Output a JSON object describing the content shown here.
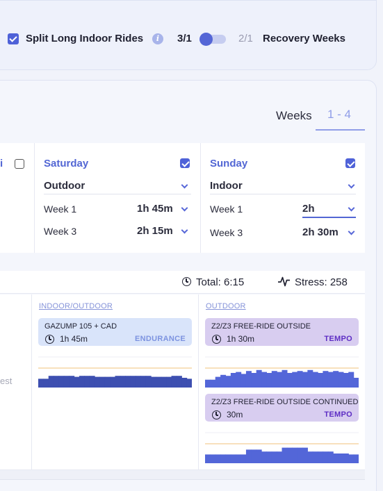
{
  "settings": {
    "split_rides_label": "Split Long Indoor Rides",
    "split_rides_checked": true,
    "ratio_left": "3/1",
    "ratio_right": "2/1",
    "recovery_label": "Recovery Weeks"
  },
  "weeks": {
    "label": "Weeks",
    "range": "1 - 4"
  },
  "days": {
    "prev_fragment": "i",
    "saturday": {
      "name": "Saturday",
      "checked": true,
      "location": "Outdoor",
      "week1_label": "Week 1",
      "week1_value": "1h 45m",
      "week3_label": "Week 3",
      "week3_value": "2h 15m"
    },
    "sunday": {
      "name": "Sunday",
      "checked": true,
      "location": "Indoor",
      "week1_label": "Week 1",
      "week1_value": "2h",
      "week3_label": "Week 3",
      "week3_value": "2h 30m"
    }
  },
  "totals": {
    "total": "Total: 6:15",
    "stress": "Stress: 258"
  },
  "schedule": {
    "rest_fragment": "est",
    "saturday": {
      "location_link": "INDOOR/OUTDOOR",
      "workouts": [
        {
          "title": "GAZUMP 105 + CAD",
          "duration": "1h 45m",
          "zone": "ENDURANCE",
          "profile": [
            0.45,
            0.45,
            0.6,
            0.6,
            0.6,
            0.6,
            0.6,
            0.55,
            0.6,
            0.6,
            0.6,
            0.55,
            0.55,
            0.55,
            0.55,
            0.6,
            0.6,
            0.6,
            0.6,
            0.6,
            0.6,
            0.6,
            0.55,
            0.55,
            0.55,
            0.55,
            0.6,
            0.6,
            0.5,
            0.45
          ]
        }
      ]
    },
    "sunday": {
      "location_link": "OUTDOOR",
      "workouts": [
        {
          "title": "Z2/Z3 FREE-RIDE OUTSIDE",
          "duration": "1h 30m",
          "zone": "TEMPO",
          "profile": [
            0.4,
            0.4,
            0.55,
            0.65,
            0.6,
            0.75,
            0.8,
            0.7,
            0.85,
            0.75,
            0.9,
            0.8,
            0.75,
            0.85,
            0.8,
            0.9,
            0.75,
            0.8,
            0.85,
            0.8,
            0.9,
            0.8,
            0.75,
            0.85,
            0.8,
            0.85,
            0.8,
            0.75,
            0.8,
            0.5
          ]
        },
        {
          "title": "Z2/Z3 FREE-RIDE OUTSIDE CONTINUED",
          "duration": "30m",
          "zone": "TEMPO",
          "profile": [
            0.45,
            0.45,
            0.45,
            0.45,
            0.45,
            0.45,
            0.45,
            0.45,
            0.7,
            0.7,
            0.7,
            0.6,
            0.6,
            0.6,
            0.6,
            0.8,
            0.8,
            0.8,
            0.8,
            0.8,
            0.6,
            0.6,
            0.6,
            0.6,
            0.6,
            0.5,
            0.5,
            0.5,
            0.45,
            0.45
          ]
        }
      ]
    }
  },
  "colors": {
    "accent": "#5266d4",
    "endurance_bar": "#3d4fb0",
    "tempo_bar": "#5366d8",
    "threshold_line": "#f2c27a"
  }
}
